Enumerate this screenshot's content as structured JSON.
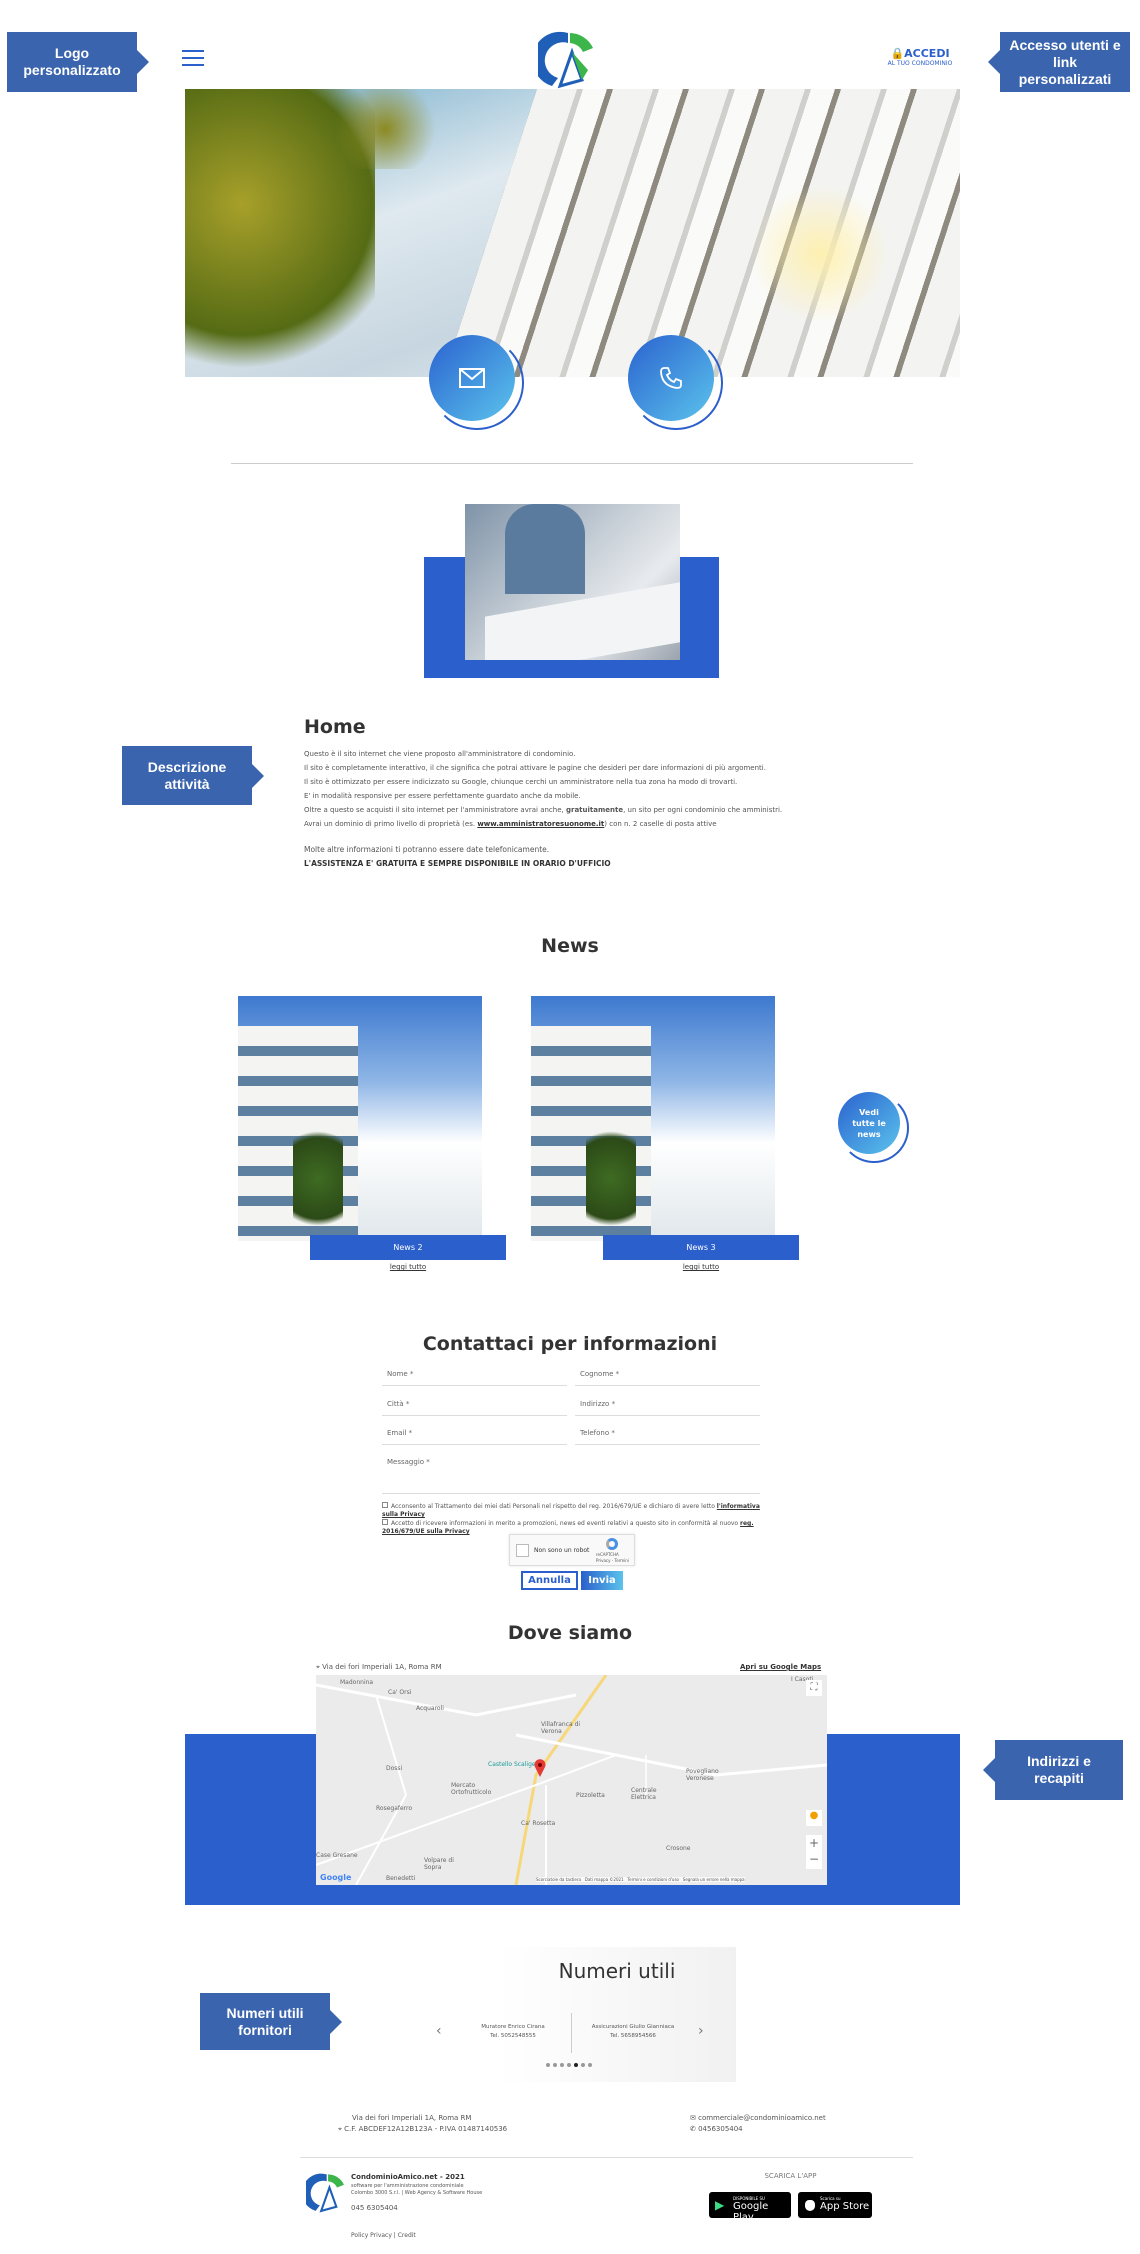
{
  "annotations": {
    "logo": "Logo personalizzato",
    "access": "Accesso utenti e link personalizzati",
    "description": "Descrizione attività",
    "addresses": "Indirizzi e recapiti",
    "numbers": "Numeri utili fornitori"
  },
  "header": {
    "login_label": "ACCEDI",
    "login_sub": "AL TUO CONDOMINIO"
  },
  "colors": {
    "accent": "#2b5fcb",
    "callout": "#3a64ad",
    "logo_green": "#3cb54a",
    "logo_blue": "#1f5fb8"
  },
  "home": {
    "title": "Home",
    "lines": [
      "Questo è il sito internet che viene proposto all'amministratore di condominio.",
      "Il sito è completamente interattivo, il che significa che potrai attivare le pagine che desideri per dare informazioni di più argomenti.",
      "Il sito è ottimizzato per essere indicizzato su Google, chiunque cerchi un amministratore nella tua zona ha modo di trovarti.",
      "E' in modalità responsive per essere perfettamente guardato anche da mobile."
    ],
    "line5_pre": "Oltre a questo se acquisti il sito internet per l'amministratore avrai anche, ",
    "line5_bold": "gratuitamente",
    "line5_post": ", un sito per ogni condominio che amministri.",
    "line6_pre": "Avrai un dominio di primo livello di proprietà (es. ",
    "line6_link": "www.amministratoresuonome.it",
    "line6_post": ") con n. 2 caselle di posta attive",
    "more": "Molte altre informazioni ti potranno essere date telefonicamente.",
    "assist": "L'ASSISTENZA E' GRATUITA E SEMPRE DISPONIBILE IN ORARIO D'UFFICIO"
  },
  "news": {
    "title": "News",
    "items": [
      {
        "label": "News 2",
        "link": "leggi tutto"
      },
      {
        "label": "News 3",
        "link": "leggi tutto"
      }
    ],
    "all": "Vedi tutte le news"
  },
  "contact": {
    "title": "Contattaci per informazioni",
    "fields": [
      "Nome *",
      "Cognome *",
      "Città *",
      "Indirizzo *",
      "Email *",
      "Telefono *"
    ],
    "message": "Messaggio *",
    "consent1_pre": "Acconsento al Trattamento dei miei dati Personali nel rispetto del reg. 2016/679/UE e dichiaro di avere letto ",
    "consent1_link": "l'informativa sulla Privacy",
    "consent2_pre": "Accetto di ricevere informazioni in merito a promozioni, news ed eventi relativi a questo sito in conformità al nuovo ",
    "consent2_link": "reg. 2016/679/UE sulla Privacy",
    "captcha": "Non sono un robot",
    "captcha_brand": "reCAPTCHA",
    "captcha_sub": "Privacy - Termini",
    "cancel": "Annulla",
    "send": "Invia"
  },
  "map": {
    "title": "Dove siamo",
    "address": "Via dei fori Imperiali 1A, Roma RM",
    "open": "Apri su Google Maps",
    "places": [
      "Madonnina",
      "Ca' Orsi",
      "Acquaroli",
      "Villafranca di Verona",
      "Castello Scaligero",
      "Dossi",
      "Mercato Ortofrutticolo",
      "Rosegaferro",
      "Ca' Rosetta",
      "Pizzoletta",
      "Centrale Elettrica",
      "Povegliano Veronese",
      "Crosone",
      "Case Gresane",
      "Volpare di Sopra",
      "Benedetti",
      "I Casoti"
    ],
    "google": "Google",
    "attribution": "Scorciatoie da tastiera   Dati mappa ©2021   Termini e condizioni d'uso   Segnala un errore nella mappa"
  },
  "numbers": {
    "title": "Numeri utili",
    "items": [
      {
        "name": "Muratore Enrico Cirana",
        "tel": "Tel. 5052548555"
      },
      {
        "name": "Assicurazioni Giulio Gianniaca",
        "tel": "Tel. 5658954566"
      }
    ],
    "dots": 7,
    "active_dot": 5
  },
  "contacts": {
    "address": "Via dei fori Imperiali 1A, Roma RM",
    "fiscal": "C.F. ABCDEF12A12B123A - P.IVA 01487140536",
    "email": "commerciale@condominioamico.net",
    "phone": "0456305404"
  },
  "footer": {
    "brand": "CondominioAmico.net - 2021",
    "tag1": "software per l'amministrazione condominiale",
    "tag2": "Colombo 3000 S.r.l. | Web Agency & Software House",
    "phone": "045 6305404",
    "links": "Policy Privacy | Credit",
    "app_title": "SCARICA L'APP",
    "gp_small": "DISPONIBILE SU",
    "gp": "Google Play",
    "as_small": "Scarica su",
    "as": "App Store"
  }
}
